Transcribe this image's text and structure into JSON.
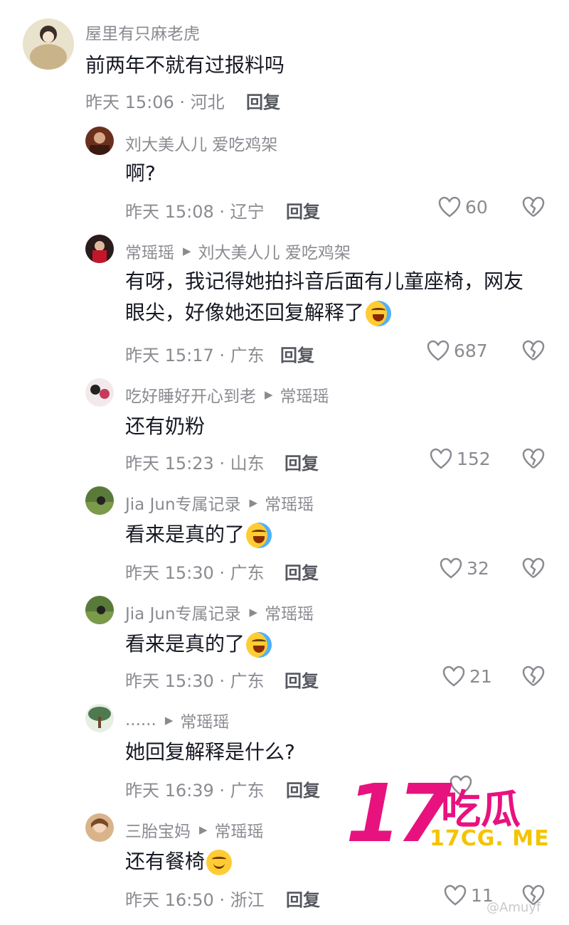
{
  "reply_label": "回复",
  "top": {
    "name": "屋里有只麻老虎",
    "text": "前两年不就有过报料吗",
    "meta": "昨天 15:06 · 河北"
  },
  "replies": [
    {
      "name": "刘大美人儿 爱吃鸡架",
      "reply_to": "",
      "text": "啊?",
      "meta": "昨天 15:08 · 辽宁",
      "likes": "60"
    },
    {
      "name": "常瑶瑶",
      "reply_to": "刘大美人儿 爱吃鸡架",
      "text_line1": "有呀，我记得她拍抖音后面有儿童座椅，网友",
      "text_line2": "眼尖，好像她还回复解释了",
      "meta": "昨天 15:17 · 广东",
      "likes": "687"
    },
    {
      "name": "吃好睡好开心到老",
      "reply_to": "常瑶瑶",
      "text": "还有奶粉",
      "meta": "昨天 15:23 · 山东",
      "likes": "152"
    },
    {
      "name": "Jia Jun专属记录",
      "reply_to": "常瑶瑶",
      "text": "看来是真的了",
      "meta": "昨天 15:30 · 广东",
      "likes": "32"
    },
    {
      "name": "Jia Jun专属记录",
      "reply_to": "常瑶瑶",
      "text": "看来是真的了",
      "meta": "昨天 15:30 · 广东",
      "likes": "21"
    },
    {
      "name": "......",
      "reply_to": "常瑶瑶",
      "text": "她回复解释是什么?",
      "meta": "昨天 16:39 · 广东",
      "likes": ""
    },
    {
      "name": "三胎宝妈",
      "reply_to": "常瑶瑶",
      "text": "还有餐椅",
      "meta": "昨天 16:50 · 浙江",
      "likes": "11"
    }
  ],
  "watermark": {
    "big": "17",
    "cn": "吃瓜",
    "site": "17CG. ME"
  },
  "credit": "@Amuyf",
  "colors": {
    "text": "#161823",
    "secondary": "#8a8b91",
    "brand": "#e8127e"
  }
}
